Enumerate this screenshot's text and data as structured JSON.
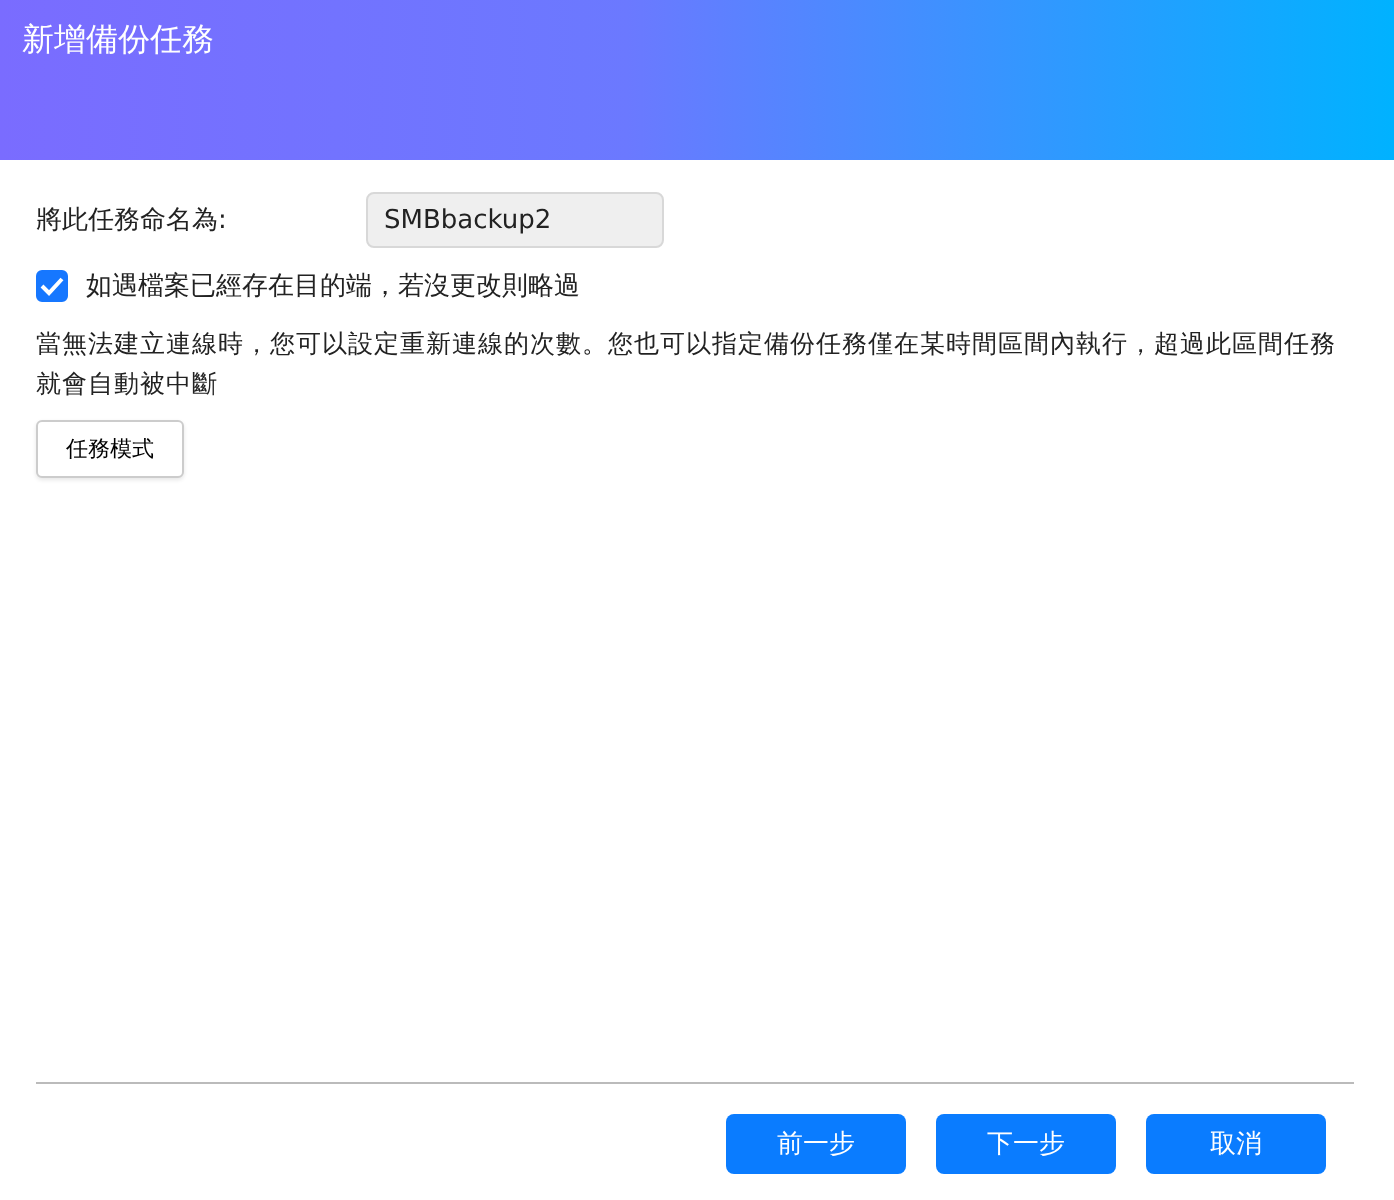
{
  "window": {
    "title": "新增備份任務"
  },
  "name_field": {
    "label": "將此任務命名為:",
    "value": "SMBbackup2"
  },
  "skip_option": {
    "label": "如遇檔案已經存在目的端，若沒更改則略過",
    "checked": true
  },
  "description": "當無法建立連線時，您可以設定重新連線的次數。您也可以指定備份任務僅在某時間區間內執行，超過此區間任務就會自動被中斷",
  "mode_button": "任務模式",
  "buttons": [
    "前一步",
    "下一步",
    "取消"
  ]
}
